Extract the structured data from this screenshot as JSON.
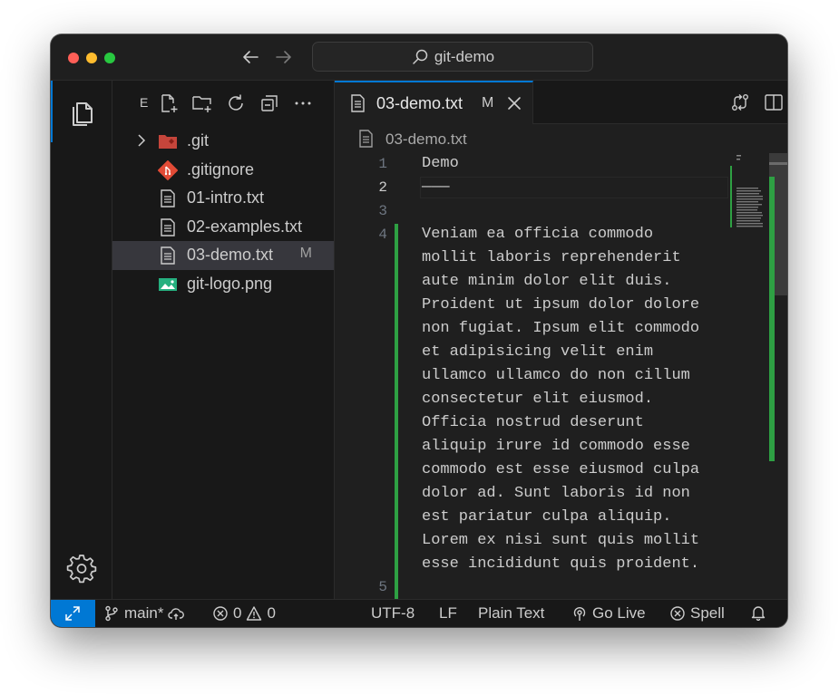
{
  "window": {
    "search_label": "git-demo",
    "traffic_lights": [
      "close",
      "minimize",
      "zoom"
    ]
  },
  "colors": {
    "accent": "#0078d4",
    "git_added": "#2ea043",
    "editor_bg": "#1f1f1f",
    "sidebar_bg": "#181818"
  },
  "activity_bar": {
    "items": [
      {
        "name": "explorer",
        "icon": "files-icon",
        "active": true
      },
      {
        "name": "manage",
        "icon": "gear-icon",
        "active": false
      }
    ]
  },
  "sidebar": {
    "title": "E",
    "toolbar": [
      "new-file-icon",
      "new-folder-icon",
      "refresh-icon",
      "collapse-all-icon",
      "more-icon"
    ],
    "files": [
      {
        "name": ".git",
        "icon": "git-folder-icon",
        "kind": "folder",
        "badge": "",
        "selected": false
      },
      {
        "name": ".gitignore",
        "icon": "git-file-icon",
        "kind": "file",
        "badge": "",
        "selected": false
      },
      {
        "name": "01-intro.txt",
        "icon": "text-file-icon",
        "kind": "file",
        "badge": "",
        "selected": false
      },
      {
        "name": "02-examples.txt",
        "icon": "text-file-icon",
        "kind": "file",
        "badge": "",
        "selected": false
      },
      {
        "name": "03-demo.txt",
        "icon": "text-file-icon",
        "kind": "file",
        "badge": "M",
        "selected": true
      },
      {
        "name": "git-logo.png",
        "icon": "image-file-icon",
        "kind": "file",
        "badge": "",
        "selected": false
      }
    ]
  },
  "editor": {
    "tab": {
      "label": "03-demo.txt",
      "badge": "M"
    },
    "actions": [
      "open-changes-icon",
      "split-editor-icon",
      "more-actions-icon"
    ],
    "breadcrumb": "03-demo.txt",
    "line_numbers": [
      "1",
      "2",
      "3",
      "4",
      "5"
    ],
    "active_line": "2",
    "lines": [
      "Demo",
      "———",
      "",
      "Veniam ea officia commodo",
      "mollit laboris reprehenderit",
      "aute minim dolor elit duis.",
      "Proident ut ipsum dolor dolore",
      "non fugiat. Ipsum elit commodo",
      "et adipisicing velit enim",
      "ullamco ullamco do non cillum",
      "consectetur elit eiusmod.",
      "Officia nostrud deserunt",
      "aliquip irure id commodo esse",
      "commodo est esse eiusmod culpa",
      "dolor ad. Sunt laboris id non",
      "est pariatur culpa aliquip.",
      "Lorem ex nisi sunt quis mollit",
      "esse incididunt quis proident.",
      ""
    ]
  },
  "statusbar": {
    "branch": "main*",
    "errors": "0",
    "warnings": "0",
    "encoding": "UTF-8",
    "eol": "LF",
    "language": "Plain Text",
    "go_live": "Go Live",
    "spell": "Spell"
  }
}
